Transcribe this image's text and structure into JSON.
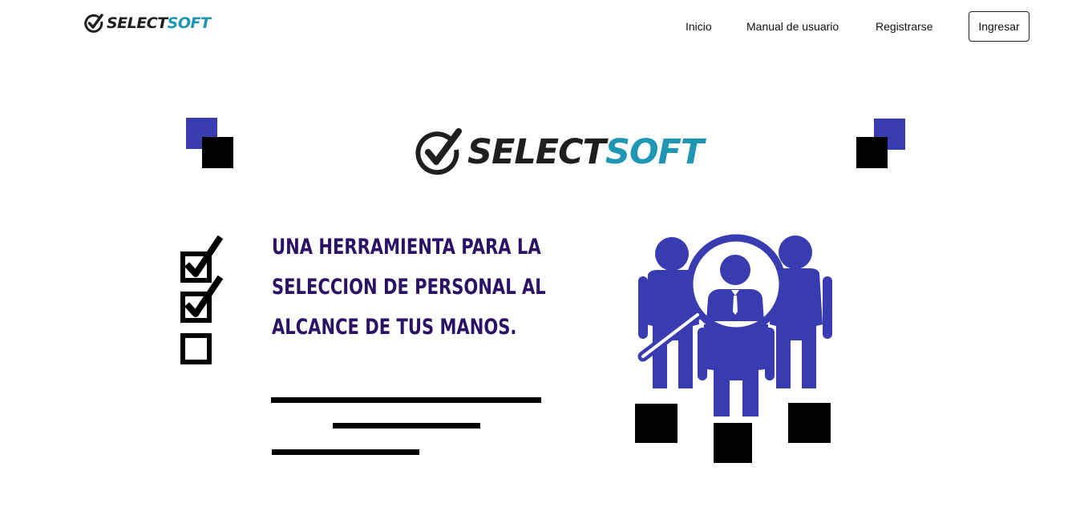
{
  "brand": {
    "part1": "SELECT",
    "part2": "SOFT"
  },
  "nav": {
    "inicio": "Inicio",
    "manual": "Manual de usuario",
    "registrarse": "Registrarse",
    "ingresar": "Ingresar"
  },
  "hero": {
    "logo_part1": "SELECT",
    "logo_part2": "SOFT",
    "headline_lines": [
      "UNA HERRAMIENTA PARA LA",
      "SELECCION DE PERSONAL AL",
      "ALCANCE DE TUS MANOS."
    ]
  },
  "colors": {
    "brand_dark": "#1f1f1f",
    "brand_teal": "#1f96b4",
    "accent_blue": "#383cb0",
    "headline_purple": "#2a1266"
  },
  "icons": [
    "check-circle-icon",
    "checkbox-checked-icon",
    "checkbox-empty-icon",
    "people-search-icon"
  ]
}
